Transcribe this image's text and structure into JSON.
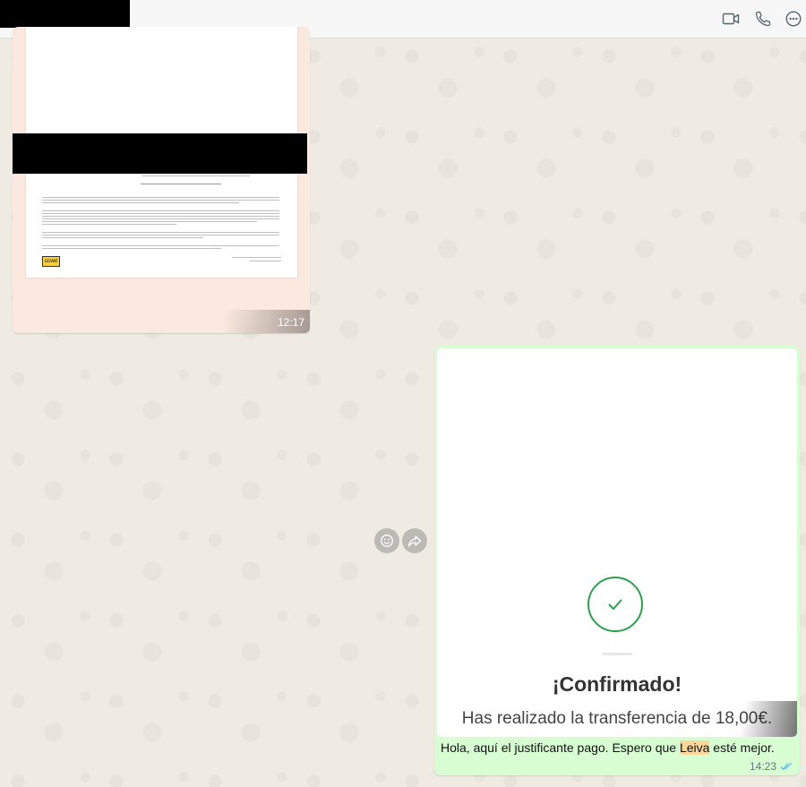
{
  "header": {
    "icons": [
      "video-call-icon",
      "voice-call-icon",
      "more-options-icon"
    ]
  },
  "incoming": {
    "time": "12:17",
    "document_logo_text": "ccvet"
  },
  "actions": [
    "emoji-react-icon",
    "forward-icon"
  ],
  "outgoing": {
    "receipt_title": "¡Confirmado!",
    "receipt_subtitle": "Has realizado la transferencia de 18,00€.",
    "text_before": "Hola, aquí el justificante pago. Espero que ",
    "text_highlight": "Leiva",
    "text_after": " esté mejor.",
    "time": "14:23",
    "status": "read"
  },
  "colors": {
    "incoming_bubble": "#fbe9df",
    "outgoing_bubble": "#d9fdd3",
    "check_green": "#2e9e4f",
    "read_ticks": "#53bdeb",
    "highlight": "#fbd89a"
  }
}
